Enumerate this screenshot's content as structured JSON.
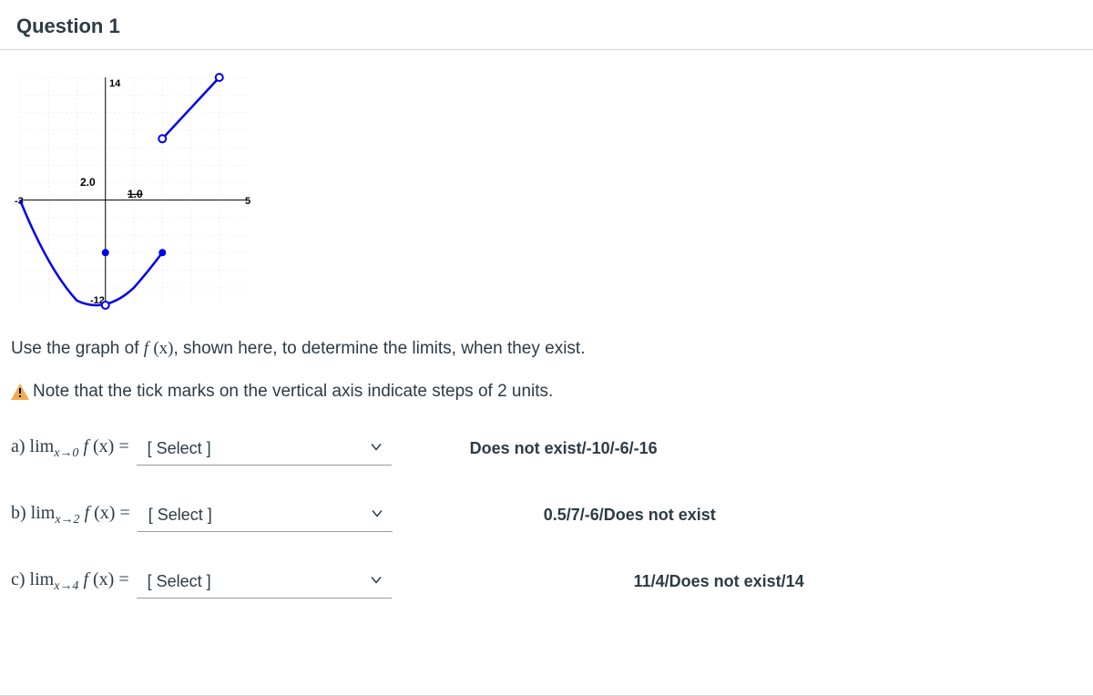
{
  "header": {
    "title": "Question 1"
  },
  "instruction_pre": "Use the graph of ",
  "instruction_post": ", shown here, to determine the limits, when they exist.",
  "warning_text": "Note that the tick marks on the vertical axis indicate steps of 2 units.",
  "parts": {
    "a": {
      "label_prefix": "a) lim",
      "sub": "x→0",
      "select_placeholder": "[ Select ]",
      "hint": "Does not exist/-10/-6/-16"
    },
    "b": {
      "label_prefix": "b) lim",
      "sub": "x→2",
      "select_placeholder": "[ Select ]",
      "hint": "0.5/7/-6/Does not exist"
    },
    "c": {
      "label_prefix": "c) lim",
      "sub": "x→4",
      "select_placeholder": "[ Select ]",
      "hint": "11/4/Does not exist/14"
    }
  },
  "fexpr_f": "f",
  "fexpr_x": "(x)",
  "equals": " = ",
  "chart_data": {
    "type": "line",
    "title": "",
    "xlabel": "",
    "ylabel": "",
    "xlim": [
      -3,
      5
    ],
    "ylim": [
      -12,
      14
    ],
    "x_ticks": [
      -3,
      5
    ],
    "y_ticks": [
      -12,
      14
    ],
    "x_label_neg3": "-3",
    "x_label_5": "5",
    "y_label_14": "14",
    "y_label_neg12": "-12",
    "text_labels": [
      {
        "text": "2.0",
        "x": -0.6,
        "y": 2
      },
      {
        "text": "1.0",
        "x": 1.0,
        "y": 0
      }
    ],
    "series": [
      {
        "name": "parabola-branch",
        "type": "curve",
        "points": [
          {
            "x": -3,
            "y": 0
          },
          {
            "x": -2,
            "y": -8
          },
          {
            "x": -1,
            "y": -11.5
          },
          {
            "x": 0,
            "y": -12
          },
          {
            "x": 1,
            "y": -10
          },
          {
            "x": 2,
            "y": -6
          }
        ],
        "open_endpoints": [
          {
            "x": 0,
            "y": -12
          }
        ],
        "closed_endpoints": [
          {
            "x": 2,
            "y": -6
          }
        ]
      },
      {
        "name": "linear-branch",
        "type": "line",
        "points": [
          {
            "x": 2,
            "y": 7
          },
          {
            "x": 4,
            "y": 14
          }
        ],
        "open_endpoints": [
          {
            "x": 2,
            "y": 7
          },
          {
            "x": 4,
            "y": 14
          }
        ]
      },
      {
        "name": "isolated-point",
        "type": "point",
        "points": [
          {
            "x": 0,
            "y": -6
          }
        ],
        "closed_endpoints": [
          {
            "x": 0,
            "y": -6
          }
        ]
      }
    ]
  }
}
